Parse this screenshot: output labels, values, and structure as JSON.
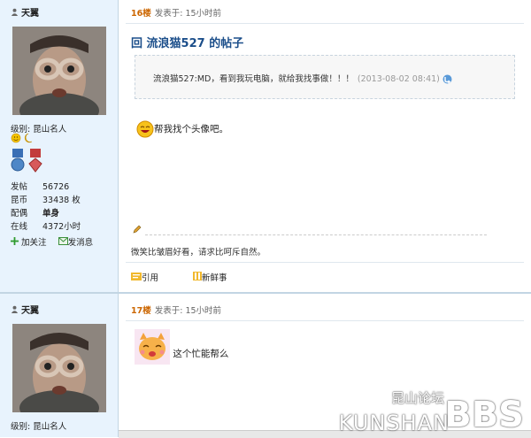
{
  "post1": {
    "author": "天翼",
    "level_label": "级别: 昆山名人",
    "stats": [
      {
        "k": "发帖",
        "v": "56726"
      },
      {
        "k": "昆币",
        "v": "33438 枚"
      },
      {
        "k": "配偶",
        "v": "单身"
      },
      {
        "k": "在线",
        "v": "4372小时"
      }
    ],
    "follow": "加关注",
    "message": "发消息",
    "floor": "16楼",
    "posted": "发表于: 15小时前",
    "reply_title": "回 流浪猫527 的帖子",
    "quote_text": "流浪猫527:MD，看到我玩电脑，就给我找事做！！！",
    "quote_time": "(2013-08-02 08:41)",
    "body": "帮我找个头像吧。",
    "signature": "微笑比皱眉好看，请求比呵斥自然。",
    "action_quote": "引用",
    "action_new": "新鲜事"
  },
  "post2": {
    "author": "天翼",
    "level_label": "级别: 昆山名人",
    "floor": "17楼",
    "posted": "发表于: 15小时前",
    "body": "这个忙能帮么"
  },
  "watermark": {
    "cn": "昆山论坛",
    "en": "KUNSHAN",
    "bbs": "BBS"
  }
}
